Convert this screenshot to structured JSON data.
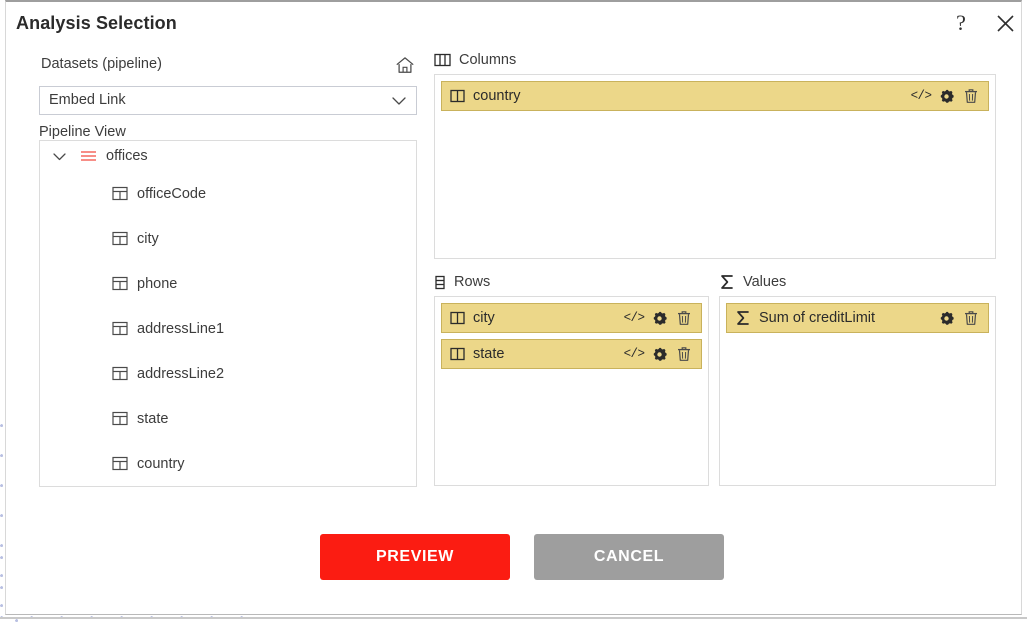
{
  "window": {
    "title": "Analysis Selection",
    "help_label": "?",
    "close_label": "✕"
  },
  "left_pane": {
    "datasets_label": "Datasets (pipeline)",
    "home_icon": "home-icon",
    "dataset_select": {
      "value": "Embed Link",
      "chevron_icon": "chevron-down-icon"
    },
    "pipeline_label": "Pipeline View",
    "tree": {
      "root": {
        "label": "offices",
        "caret_icon": "chevron-down-icon",
        "icon": "list-lines-icon",
        "expanded": true
      },
      "children": [
        {
          "label": "officeCode",
          "icon": "table-field-icon"
        },
        {
          "label": "city",
          "icon": "table-field-icon"
        },
        {
          "label": "phone",
          "icon": "table-field-icon"
        },
        {
          "label": "addressLine1",
          "icon": "table-field-icon"
        },
        {
          "label": "addressLine2",
          "icon": "table-field-icon"
        },
        {
          "label": "state",
          "icon": "table-field-icon"
        },
        {
          "label": "country",
          "icon": "table-field-icon"
        }
      ]
    }
  },
  "panels": {
    "columns": {
      "title": "Columns",
      "icon": "columns-icon",
      "chips": [
        {
          "label": "country",
          "icon": "column-field-icon",
          "code_label": "</>",
          "gear_icon": "gear-icon",
          "trash_icon": "trash-icon",
          "has_code": true
        }
      ]
    },
    "rows": {
      "title": "Rows",
      "icon": "rows-icon",
      "chips": [
        {
          "label": "city",
          "icon": "column-field-icon",
          "code_label": "</>",
          "gear_icon": "gear-icon",
          "trash_icon": "trash-icon",
          "has_code": true
        },
        {
          "label": "state",
          "icon": "column-field-icon",
          "code_label": "</>",
          "gear_icon": "gear-icon",
          "trash_icon": "trash-icon",
          "has_code": true
        }
      ]
    },
    "values": {
      "title": "Values",
      "icon": "sigma-icon",
      "chips": [
        {
          "label": "Sum of creditLimit",
          "icon": "sigma-icon",
          "code_label": "",
          "gear_icon": "gear-icon",
          "trash_icon": "trash-icon",
          "has_code": false
        }
      ]
    }
  },
  "footer": {
    "preview_label": "PREVIEW",
    "cancel_label": "CANCEL"
  },
  "colors": {
    "preview_button": "#fb1c12",
    "cancel_button": "#9e9e9e",
    "chip_background": "#ecd789",
    "chip_border": "#c9b25c",
    "tree_root_icon": "#f4695f",
    "dot_pattern": "#b9c0e2"
  }
}
